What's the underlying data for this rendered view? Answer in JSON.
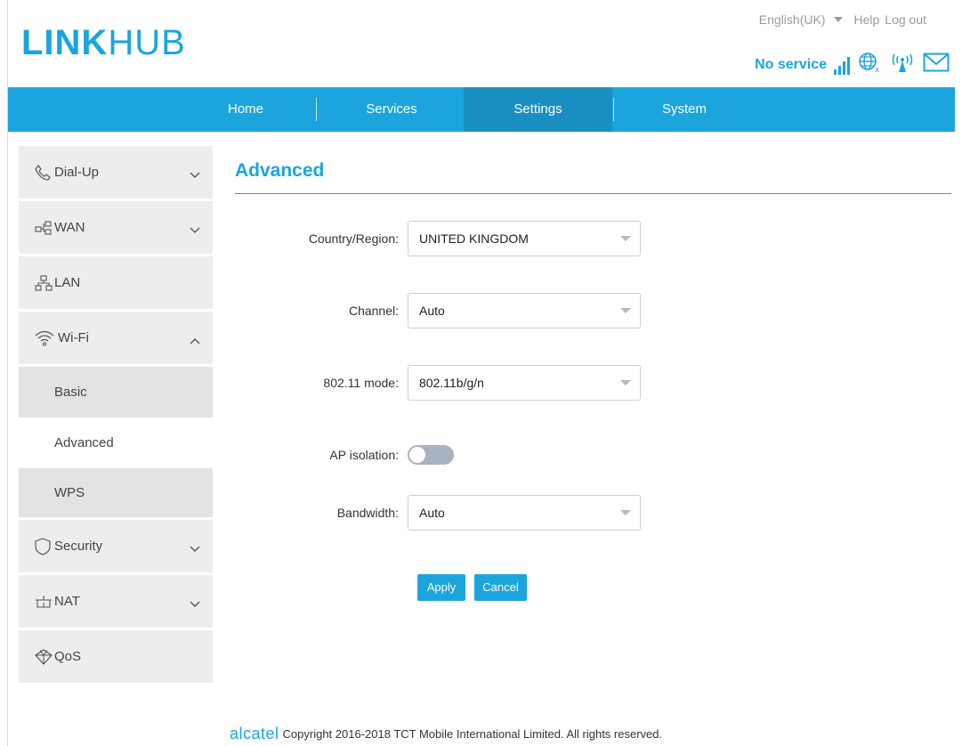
{
  "header": {
    "logo_bold": "LINK",
    "logo_thin": "HUB",
    "language": "English(UK)",
    "help": "Help",
    "logout": "Log out",
    "status_text": "No service",
    "accent": "#1ba5dc"
  },
  "nav": {
    "items": [
      {
        "label": "Home"
      },
      {
        "label": "Services"
      },
      {
        "label": "Settings"
      },
      {
        "label": "System"
      }
    ],
    "active": "Settings"
  },
  "sidebar": {
    "items": [
      {
        "label": "Dial-Up",
        "icon": "phone-icon"
      },
      {
        "label": "WAN",
        "icon": "wan-icon"
      },
      {
        "label": "LAN",
        "icon": "lan-icon"
      },
      {
        "label": "Wi-Fi",
        "icon": "wifi-icon"
      },
      {
        "label": "Security",
        "icon": "shield-icon"
      },
      {
        "label": "NAT",
        "icon": "nat-icon"
      },
      {
        "label": "QoS",
        "icon": "qos-icon"
      }
    ],
    "wifi_sub": [
      {
        "label": "Basic"
      },
      {
        "label": "Advanced"
      },
      {
        "label": "WPS"
      }
    ]
  },
  "main": {
    "title": "Advanced",
    "country_label": "Country/Region:",
    "country_value": "UNITED KINGDOM",
    "channel_label": "Channel:",
    "channel_value": "Auto",
    "mode_label": "802.11 mode:",
    "mode_value": "802.11b/g/n",
    "ap_label": "AP isolation:",
    "ap_enabled": false,
    "bandwidth_label": "Bandwidth:",
    "bandwidth_value": "Auto",
    "apply": "Apply",
    "cancel": "Cancel"
  },
  "footer": {
    "brand": "alcatel",
    "copyright": "Copyright 2016-2018 TCT Mobile International Limited. All rights reserved."
  }
}
